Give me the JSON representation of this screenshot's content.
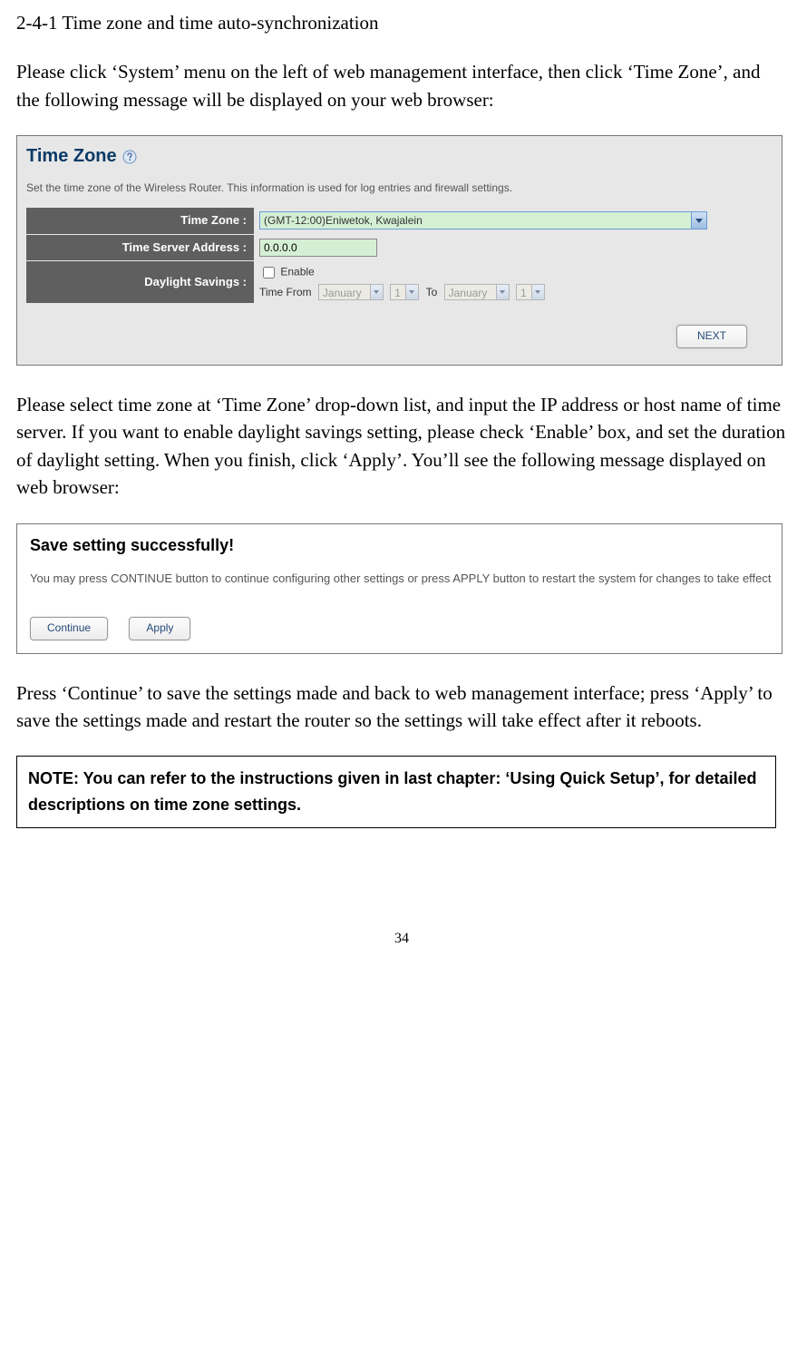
{
  "doc": {
    "section_title": "2-4-1 Time zone and time auto-synchronization",
    "para1": "Please click ‘System’ menu on the left of web management interface, then click ‘Time Zone’, and the following message will be displayed on your web browser:",
    "para2": "Please select time zone at ‘Time Zone’ drop-down list, and input the IP address or host name of time server. If you want to enable daylight savings setting, please check ‘Enable’ box, and set the duration of daylight setting. When you finish, click ‘Apply’. You’ll see the following message displayed on web browser:",
    "para3": "Press ‘Continue’ to save the settings made and back to web management interface; press ‘Apply’ to save the settings made and restart the router so the settings will take effect after it reboots.",
    "note": "NOTE: You can refer to the instructions given in last chapter: ‘Using Quick Setup’, for detailed descriptions on time zone settings.",
    "page_number": "34"
  },
  "panel1": {
    "title": "Time Zone",
    "desc": "Set the time zone of the Wireless Router. This information is used for log entries and firewall settings.",
    "labels": {
      "tz": "Time Zone :",
      "server": "Time Server Address :",
      "ds": "Daylight Savings :"
    },
    "fields": {
      "tz_value": "(GMT-12:00)Eniwetok, Kwajalein",
      "server_value": "0.0.0.0",
      "enable_label": "Enable",
      "time_from_label": "Time From",
      "to_label": "To",
      "month1": "January",
      "day1": "1",
      "month2": "January",
      "day2": "1"
    },
    "next_btn": "NEXT"
  },
  "panel2": {
    "title": "Save setting successfully!",
    "desc": "You may press CONTINUE button to continue configuring other settings or press APPLY button to restart the system for changes to take effect",
    "continue_btn": "Continue",
    "apply_btn": "Apply"
  }
}
